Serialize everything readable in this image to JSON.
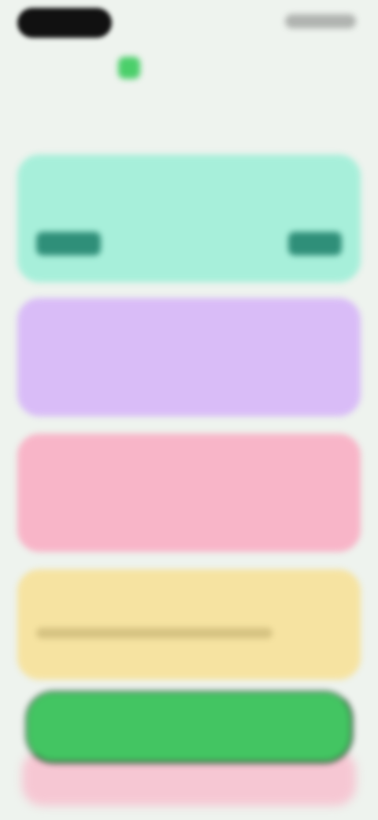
{
  "app": {
    "logo_text": "",
    "heading_primary": "",
    "heading_accent": ""
  },
  "cards": [
    {
      "label": ""
    },
    {
      "label": ""
    },
    {
      "label": ""
    },
    {
      "label": ""
    }
  ],
  "cta": {
    "label": ""
  },
  "colors": {
    "background": "#eef3ee",
    "green_card": "#a7efda",
    "purple_card": "#d9bcf7",
    "pink_card": "#f8b5c8",
    "yellow_card": "#f6e3a1",
    "cta": "#43c562"
  }
}
